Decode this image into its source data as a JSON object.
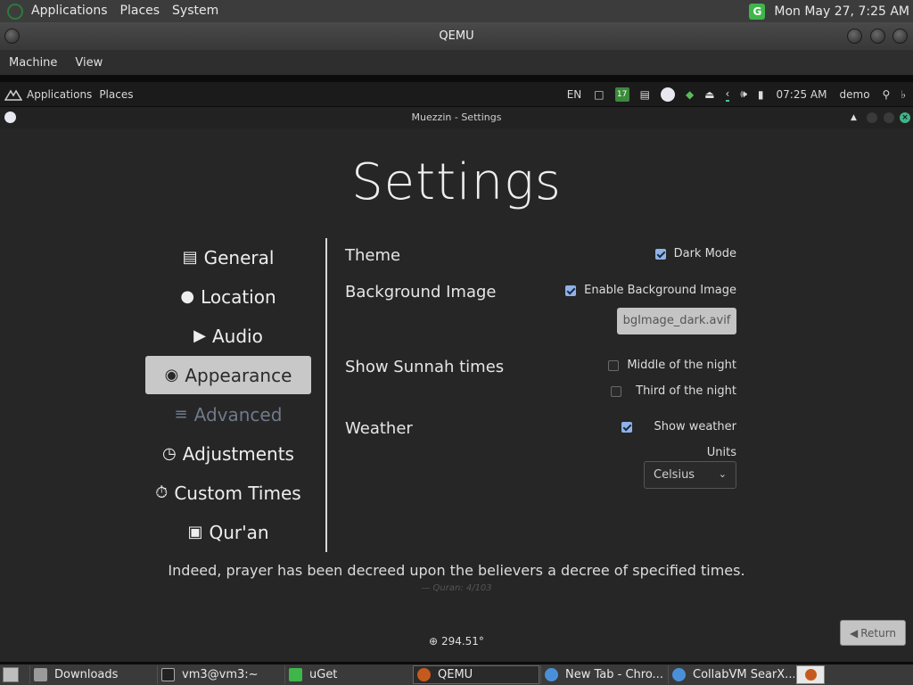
{
  "host_panel": {
    "menus": [
      "Applications",
      "Places",
      "System"
    ],
    "clock": "Mon May 27,  7:25 AM",
    "tray_icon": "uget-icon"
  },
  "qemu": {
    "title": "QEMU",
    "menus": [
      "Machine",
      "View"
    ]
  },
  "guest_panel": {
    "menus": [
      "Applications",
      "Places"
    ],
    "lang": "EN",
    "calendar_day": "17",
    "time": "07:25 AM",
    "user": "demo"
  },
  "window": {
    "title": "Muezzin - Settings"
  },
  "settings": {
    "heading": "Settings",
    "nav": [
      {
        "label": "General",
        "icon": "kaaba-icon",
        "active": false
      },
      {
        "label": "Location",
        "icon": "map-pin-icon",
        "active": false
      },
      {
        "label": "Audio",
        "icon": "volume-icon",
        "active": false
      },
      {
        "label": "Appearance",
        "icon": "palette-icon",
        "active": true
      },
      {
        "label": "Advanced",
        "icon": "sliders-icon",
        "active": false
      },
      {
        "label": "Adjustments",
        "icon": "clock-icon",
        "active": false
      },
      {
        "label": "Custom Times",
        "icon": "stopwatch-icon",
        "active": false
      },
      {
        "label": "Qur'an",
        "icon": "quran-icon",
        "active": false
      }
    ],
    "theme": {
      "label": "Theme",
      "dark_mode_label": "Dark Mode",
      "dark_mode": true
    },
    "background": {
      "label": "Background Image",
      "enable_label": "Enable Background Image",
      "enabled": true,
      "file_button": "bgImage_dark.avif"
    },
    "sunnah": {
      "label": "Show Sunnah times",
      "middle_label": "Middle of the night",
      "middle": false,
      "third_label": "Third of the night",
      "third": false
    },
    "weather": {
      "label": "Weather",
      "show_label": "Show weather",
      "show": true,
      "units_label": "Units",
      "units_value": "Celsius"
    },
    "quote": "Indeed, prayer has been decreed upon the believers a decree of specified times.",
    "quote_source": "— Quran: 4/103",
    "qibla": "294.51°",
    "return_label": "Return"
  },
  "taskbar": [
    {
      "label": "Downloads",
      "icon": "folder-icon"
    },
    {
      "label": "vm3@vm3:~",
      "icon": "terminal-icon"
    },
    {
      "label": "uGet",
      "icon": "uget-icon"
    },
    {
      "label": "QEMU",
      "icon": "qemu-icon",
      "active": true
    },
    {
      "label": "New Tab - Chro...",
      "icon": "chrome-icon"
    },
    {
      "label": "CollabVM SearX...",
      "icon": "chrome-icon"
    }
  ],
  "colors": {
    "accent_check": "#8fb3e8",
    "active_nav_bg": "#c8c8c8",
    "app_bg": "#262626",
    "uget_green": "#3fb64a"
  }
}
